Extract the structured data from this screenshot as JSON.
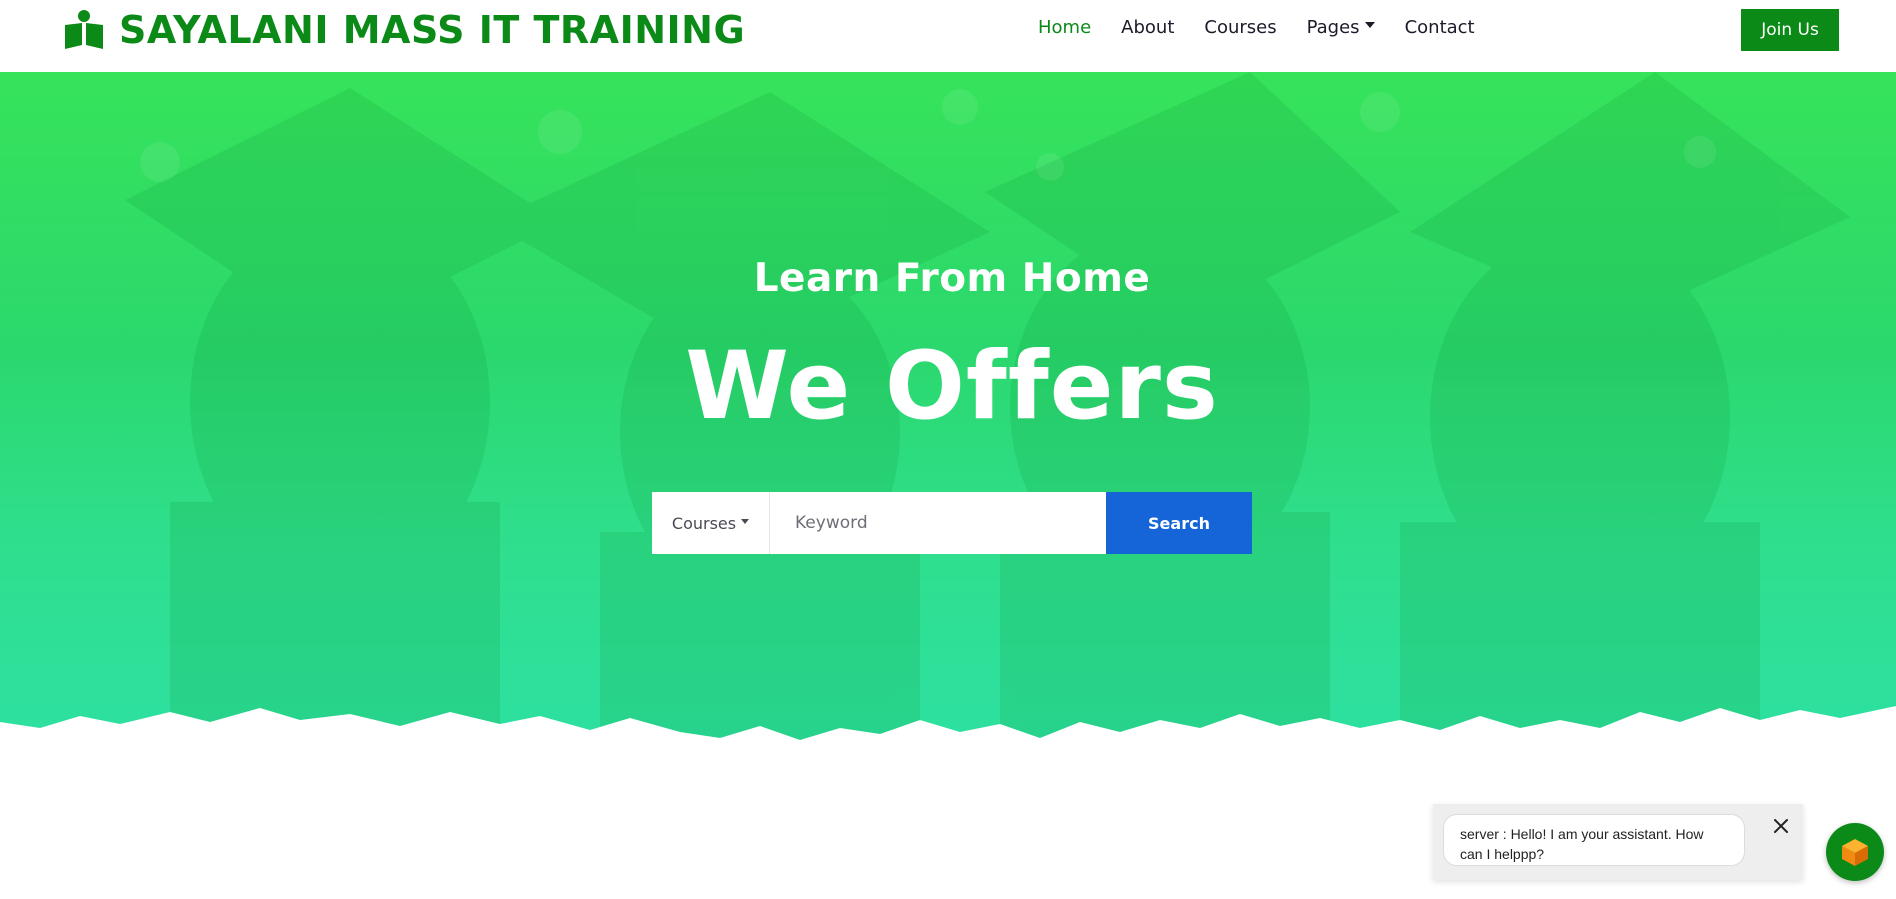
{
  "brand": {
    "name": "SAYALANI MASS IT TRAINING",
    "color": "#0b8a18",
    "icon": "book-reader-icon"
  },
  "nav": {
    "items": [
      {
        "label": "Home",
        "active": true
      },
      {
        "label": "About",
        "active": false
      },
      {
        "label": "Courses",
        "active": false
      },
      {
        "label": "Pages",
        "active": false,
        "dropdown": true
      },
      {
        "label": "Contact",
        "active": false
      }
    ],
    "cta_label": "Join Us"
  },
  "hero": {
    "subtitle": "Learn From Home",
    "title": "We Offers",
    "search": {
      "category_label": "Courses",
      "placeholder": "Keyword",
      "value": "",
      "button_label": "Search",
      "button_color": "#1565d8"
    },
    "overlay_colors": [
      "#36e35a",
      "#2de0a2"
    ]
  },
  "chat": {
    "message": "server : Hello! I am your assistant. How can I helppp?",
    "close_icon": "close-icon",
    "launcher_icon": "cube-icon"
  }
}
